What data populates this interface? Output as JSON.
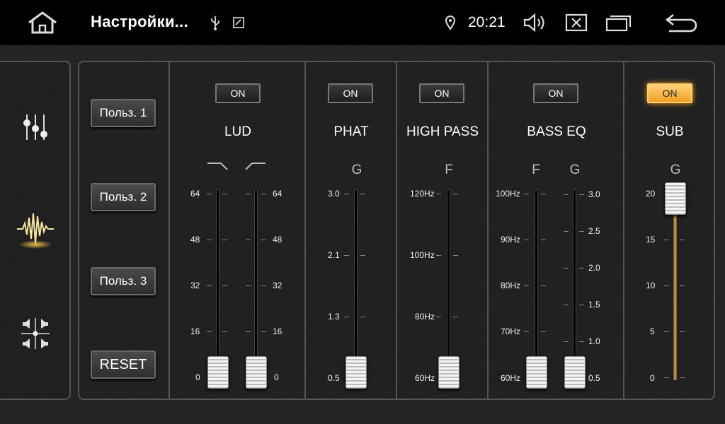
{
  "status_bar": {
    "title": "Настройки...",
    "time": "20:21",
    "icons": [
      "home-icon",
      "usb-icon",
      "screenshot-icon",
      "location-icon",
      "volume-icon",
      "close-app-icon",
      "recent-apps-icon",
      "back-icon"
    ]
  },
  "sidebar": {
    "items": [
      {
        "name": "equalizer-sliders-icon",
        "active": false
      },
      {
        "name": "sound-wave-icon",
        "active": true
      },
      {
        "name": "speaker-balance-icon",
        "active": false
      }
    ]
  },
  "presets": {
    "user1": "Польз. 1",
    "user2": "Польз. 2",
    "user3": "Польз. 3",
    "reset": "RESET"
  },
  "sections": {
    "lud": {
      "title": "LUD",
      "on_label": "ON",
      "enabled": false,
      "ticks_left": [
        "64",
        "48",
        "32",
        "16",
        "0"
      ],
      "ticks_right": [
        "64",
        "48",
        "32",
        "16",
        "0"
      ],
      "slider_low": {
        "value": 0,
        "max": 64
      },
      "slider_high": {
        "value": 0,
        "max": 64
      }
    },
    "phat": {
      "title": "PHAT",
      "on_label": "ON",
      "enabled": false,
      "letter": "G",
      "ticks": [
        "3.0",
        "2.1",
        "1.3",
        "0.5"
      ],
      "slider": {
        "value": "0.5"
      }
    },
    "high_pass": {
      "title": "HIGH PASS",
      "on_label": "ON",
      "enabled": false,
      "letter": "F",
      "ticks": [
        "120Hz",
        "100Hz",
        "80Hz",
        "60Hz"
      ],
      "slider": {
        "value": "60Hz"
      }
    },
    "bass_eq": {
      "title": "BASS EQ",
      "on_label": "ON",
      "enabled": false,
      "letter_f": "F",
      "letter_g": "G",
      "ticks_f": [
        "100Hz",
        "90Hz",
        "80Hz",
        "70Hz",
        "60Hz"
      ],
      "ticks_g": [
        "3.0",
        "2.5",
        "2.0",
        "1.5",
        "1.0",
        "0.5"
      ],
      "slider_f": {
        "value": "60Hz"
      },
      "slider_g": {
        "value": "0.5"
      }
    },
    "sub": {
      "title": "SUB",
      "on_label": "ON",
      "enabled": true,
      "letter": "G",
      "ticks": [
        "20",
        "15",
        "10",
        "5",
        "0"
      ],
      "slider": {
        "value": 20,
        "max": 20
      }
    }
  },
  "colors": {
    "accent": "#f0a020",
    "panel_border": "#555555",
    "background": "#1c1c1c"
  }
}
